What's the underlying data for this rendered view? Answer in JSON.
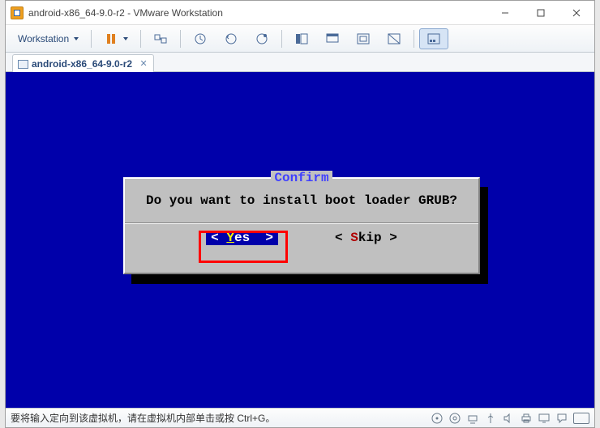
{
  "window": {
    "title": "android-x86_64-9.0-r2 - VMware Workstation"
  },
  "toolbar": {
    "workstation_label": "Workstation"
  },
  "tab": {
    "label": "android-x86_64-9.0-r2"
  },
  "tui": {
    "title": "Confirm",
    "message": "Do you want to install boot loader GRUB?",
    "yes_bracket_open": "<",
    "yes_hot": "Y",
    "yes_rest": "es",
    "yes_bracket_close": ">",
    "skip_bracket_open": "<",
    "skip_hot": "S",
    "skip_rest": "kip",
    "skip_bracket_close": ">"
  },
  "status": {
    "text": "要将输入定向到该虚拟机，请在虚拟机内部单击或按 Ctrl+G。"
  }
}
